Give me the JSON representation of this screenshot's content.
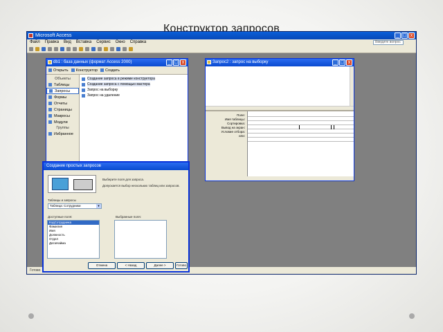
{
  "slide": {
    "title": "Конструктор запросов"
  },
  "app": {
    "title": "Microsoft Access",
    "menu": [
      "Файл",
      "Правка",
      "Вид",
      "Вставка",
      "Сервис",
      "Окно",
      "Справка"
    ],
    "help_placeholder": "Введите вопрос",
    "window_buttons": [
      "_",
      "□",
      "x"
    ],
    "status": "Готово"
  },
  "db_window": {
    "title": "db1 : база данных (формат Access 2000)",
    "toolbar": [
      "Открыть",
      "Конструктор",
      "Создать"
    ],
    "objects_header": "Объекты",
    "objects": [
      "Таблицы",
      "Запросы",
      "Формы",
      "Отчеты",
      "Страницы",
      "Макросы",
      "Модули"
    ],
    "groups_header": "Группы",
    "groups": [
      "Избранное"
    ],
    "list": [
      "Создание запроса в режиме конструктора",
      "Создание запроса с помощью мастера",
      "Запрос на выборку",
      "Запрос на удаление"
    ]
  },
  "query_window": {
    "title": "Запрос2 : запрос на выборку",
    "row_labels": [
      "Поле:",
      "Имя таблицы:",
      "Сортировка:",
      "Вывод на экран:",
      "Условие отбора:",
      "или:"
    ]
  },
  "dialog": {
    "title": "Создание простых запросов",
    "prompt1": "Выберите поля для запроса.",
    "prompt2": "Допускается выбор нескольких таблиц или запросов.",
    "tables_label": "Таблицы и запросы",
    "tables_value": "Таблица: Сотрудники",
    "available_label": "Доступные поля:",
    "selected_label": "Выбранные поля:",
    "available_fields": [
      "КодСотрудника",
      "Фамилия",
      "Имя",
      "Должность",
      "Отдел",
      "ДатаНайма"
    ],
    "move_buttons": [
      ">",
      ">>",
      "<",
      "<<"
    ],
    "buttons": [
      "Отмена",
      "< Назад",
      "Далее >",
      "Готово"
    ]
  }
}
